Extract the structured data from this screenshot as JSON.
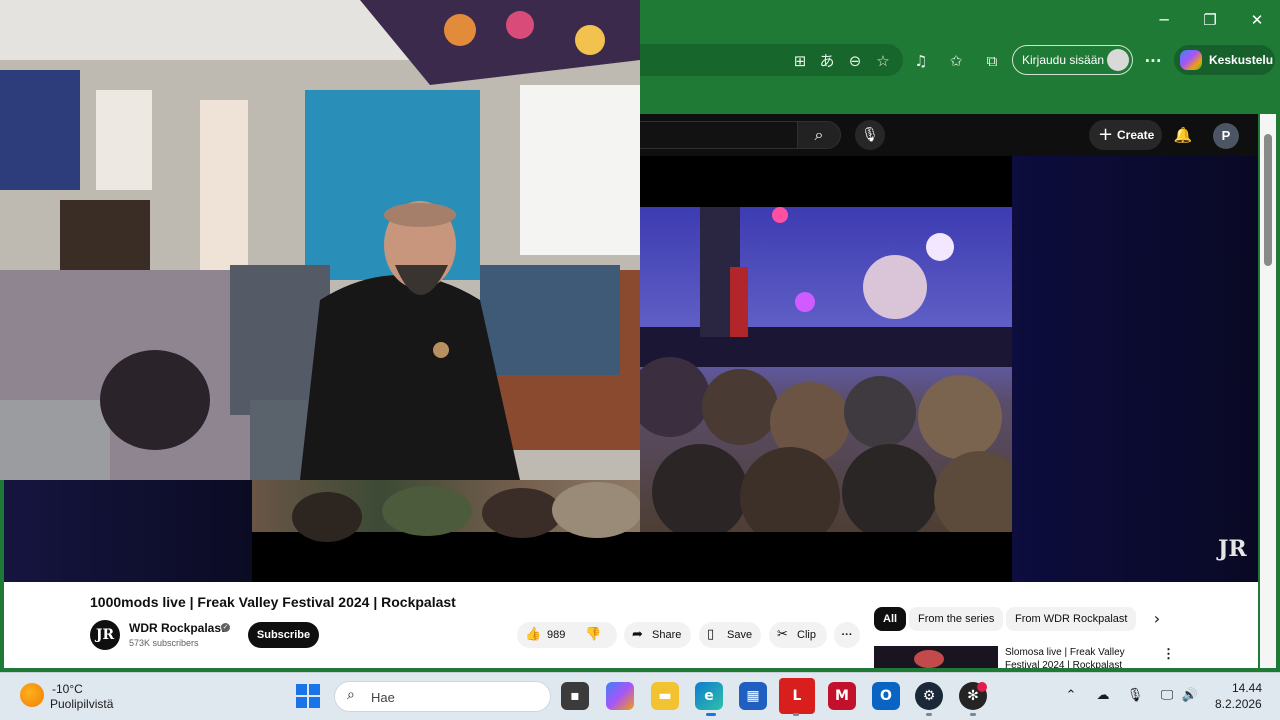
{
  "browser": {
    "window_controls": {
      "minimize": "─",
      "restore": "❐",
      "close": "✕"
    },
    "toolbar_icons": [
      "apps-icon",
      "translate-icon",
      "zoom-icon",
      "favorite-star-icon",
      "media-icon",
      "favorites-icon",
      "collections-icon"
    ],
    "signin_label": "Kirjaudu sisään",
    "more_label": "···",
    "copilot_label": "Keskustelu",
    "accent": "#1f7a35"
  },
  "youtube": {
    "create_label": "Create",
    "avatar_letter": "P",
    "video": {
      "title": "1000mods live | Freak Valley Festival 2024 | Rockpalast",
      "watermark": "JR"
    },
    "channel": {
      "name": "WDR Rockpalast",
      "subscribers": "573K subscribers",
      "avatar_letter": "JR",
      "subscribe_label": "Subscribe"
    },
    "actions": {
      "likes": "989",
      "share": "Share",
      "save": "Save",
      "clip": "Clip",
      "more": "···"
    },
    "chips": [
      "All",
      "From the series",
      "From WDR Rockpalast"
    ],
    "recommendation": {
      "title": "Slomosa live | Freak Valley Festival 2024 | Rockpalast"
    }
  },
  "taskbar": {
    "weather": {
      "temp": "-10°C",
      "desc": "Puolipilvistä"
    },
    "search_placeholder": "Hae",
    "clock": {
      "time": "14.44",
      "date": "8.2.2026"
    }
  }
}
